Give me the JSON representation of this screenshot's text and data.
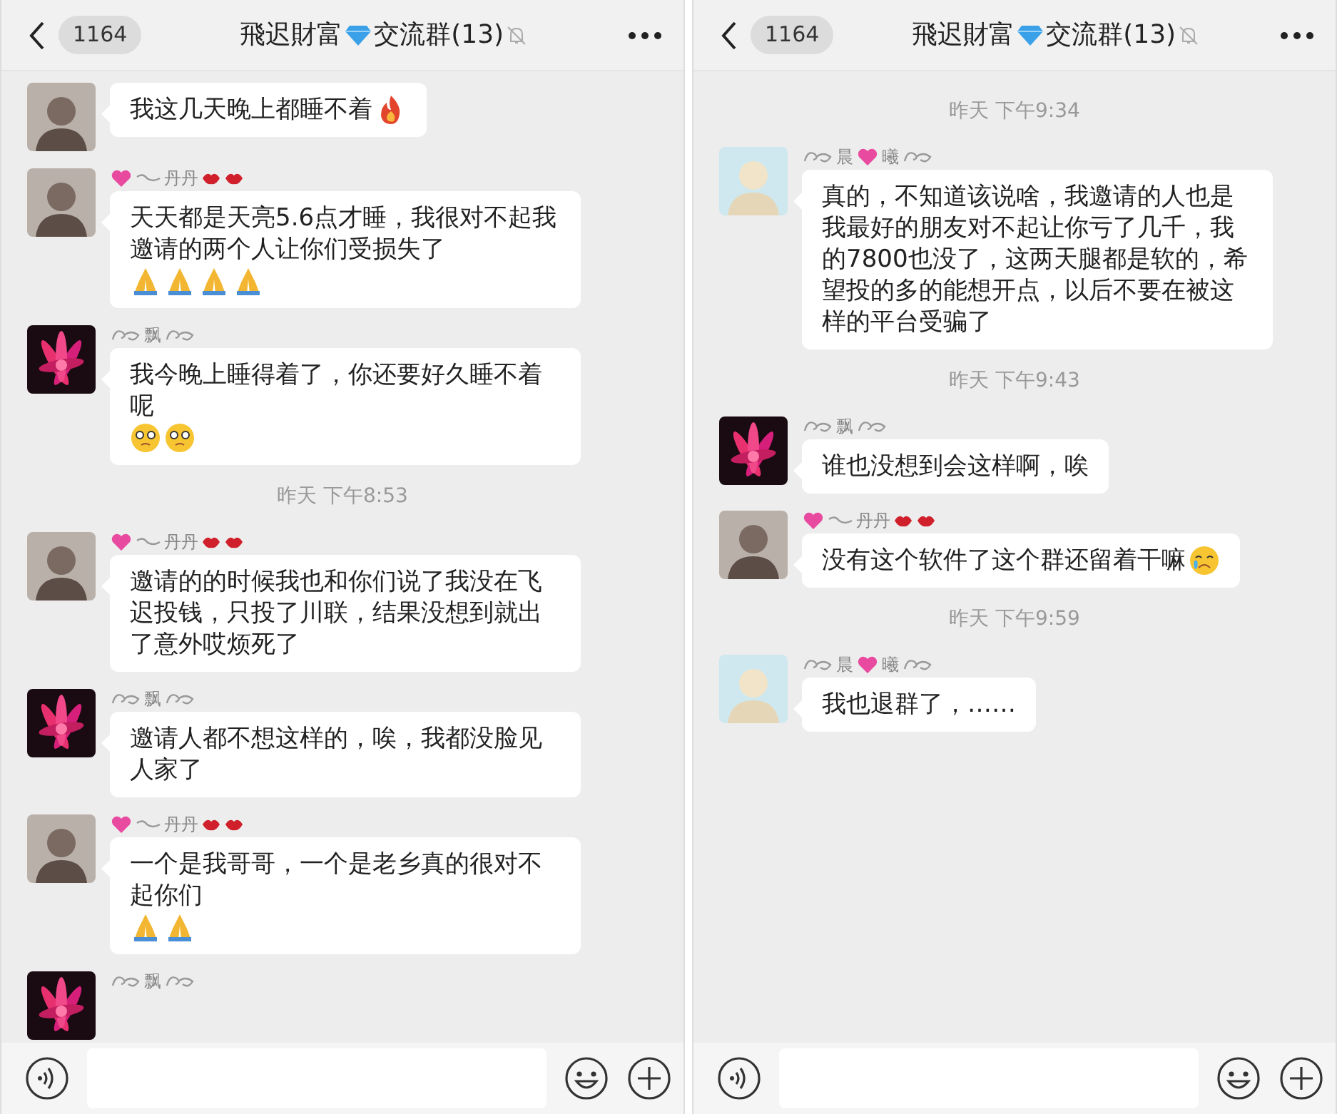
{
  "panels": [
    {
      "header": {
        "back_count": "1164",
        "title": [
          "飛迟財富",
          "交流群(13)"
        ],
        "muted": true
      },
      "items": [
        {
          "kind": "message",
          "avatar": {
            "kind": "person"
          },
          "text": "我这几天晚上都睡不着",
          "emojis": [
            {
              "kind": "flame"
            }
          ]
        },
        {
          "kind": "message",
          "avatar": {
            "kind": "person"
          },
          "name": [
            {
              "kind": "heart"
            },
            {
              "kind": "swoosh"
            },
            {
              "kind": "text",
              "text": "丹丹"
            },
            {
              "kind": "lips"
            },
            {
              "kind": "lips"
            }
          ],
          "text": "天天都是天亮5.6点才睡，我很对不起我邀请的两个人让你们受损失了",
          "emojis": [
            {
              "kind": "pray"
            },
            {
              "kind": "pray"
            },
            {
              "kind": "pray"
            },
            {
              "kind": "pray"
            }
          ]
        },
        {
          "kind": "message",
          "avatar": {
            "kind": "flower"
          },
          "name": [
            {
              "kind": "flourish"
            },
            {
              "kind": "text",
              "text": "飘"
            },
            {
              "kind": "flourish"
            }
          ],
          "text": "我今晚上睡得着了，你还要好久睡不着呢",
          "emojis": [
            {
              "kind": "pleading"
            },
            {
              "kind": "pleading"
            }
          ]
        },
        {
          "kind": "time",
          "text": "昨天 下午8:53"
        },
        {
          "kind": "message",
          "avatar": {
            "kind": "person"
          },
          "name": [
            {
              "kind": "heart"
            },
            {
              "kind": "swoosh"
            },
            {
              "kind": "text",
              "text": "丹丹"
            },
            {
              "kind": "lips"
            },
            {
              "kind": "lips"
            }
          ],
          "text": "邀请的的时候我也和你们说了我没在飞迟投钱，只投了川联，结果没想到就出了意外哎烦死了"
        },
        {
          "kind": "message",
          "avatar": {
            "kind": "flower"
          },
          "name": [
            {
              "kind": "flourish"
            },
            {
              "kind": "text",
              "text": "飘"
            },
            {
              "kind": "flourish"
            }
          ],
          "text": "邀请人都不想这样的，唉，我都没脸见人家了"
        },
        {
          "kind": "message",
          "avatar": {
            "kind": "person"
          },
          "name": [
            {
              "kind": "heart"
            },
            {
              "kind": "swoosh"
            },
            {
              "kind": "text",
              "text": "丹丹"
            },
            {
              "kind": "lips"
            },
            {
              "kind": "lips"
            }
          ],
          "text": "一个是我哥哥，一个是老乡真的很对不起你们",
          "emojis": [
            {
              "kind": "pray"
            },
            {
              "kind": "pray"
            }
          ]
        },
        {
          "kind": "partial",
          "avatar": {
            "kind": "flower"
          },
          "name": [
            {
              "kind": "flourish"
            },
            {
              "kind": "text",
              "text": "飘"
            },
            {
              "kind": "flourish"
            }
          ]
        }
      ]
    },
    {
      "header": {
        "back_count": "1164",
        "title": [
          "飛迟財富",
          "交流群(13)"
        ],
        "muted": true
      },
      "items": [
        {
          "kind": "time",
          "text": "昨天 下午9:34"
        },
        {
          "kind": "message",
          "avatar": {
            "kind": "person-light"
          },
          "name": [
            {
              "kind": "flourish"
            },
            {
              "kind": "text",
              "text": "晨"
            },
            {
              "kind": "heart"
            },
            {
              "kind": "text",
              "text": "曦"
            },
            {
              "kind": "flourish"
            }
          ],
          "text": "真的，不知道该说啥，我邀请的人也是我最好的朋友对不起让你亏了几千，我的7800也没了，这两天腿都是软的，希望投的多的能想开点，以后不要在被这样的平台受骗了"
        },
        {
          "kind": "time",
          "text": "昨天 下午9:43"
        },
        {
          "kind": "message",
          "avatar": {
            "kind": "flower"
          },
          "name": [
            {
              "kind": "flourish"
            },
            {
              "kind": "text",
              "text": "飘"
            },
            {
              "kind": "flourish"
            }
          ],
          "text": "谁也没想到会这样啊，唉"
        },
        {
          "kind": "message",
          "avatar": {
            "kind": "person"
          },
          "name": [
            {
              "kind": "heart"
            },
            {
              "kind": "swoosh"
            },
            {
              "kind": "text",
              "text": "丹丹"
            },
            {
              "kind": "lips"
            },
            {
              "kind": "lips"
            }
          ],
          "text": "没有这个软件了这个群还留着干嘛",
          "emojis": [
            {
              "kind": "crying"
            }
          ]
        },
        {
          "kind": "time",
          "text": "昨天 下午9:59"
        },
        {
          "kind": "message",
          "avatar": {
            "kind": "person-light"
          },
          "name": [
            {
              "kind": "flourish"
            },
            {
              "kind": "text",
              "text": "晨"
            },
            {
              "kind": "heart"
            },
            {
              "kind": "text",
              "text": "曦"
            },
            {
              "kind": "flourish"
            }
          ],
          "text": "我也退群了，……"
        }
      ]
    }
  ]
}
